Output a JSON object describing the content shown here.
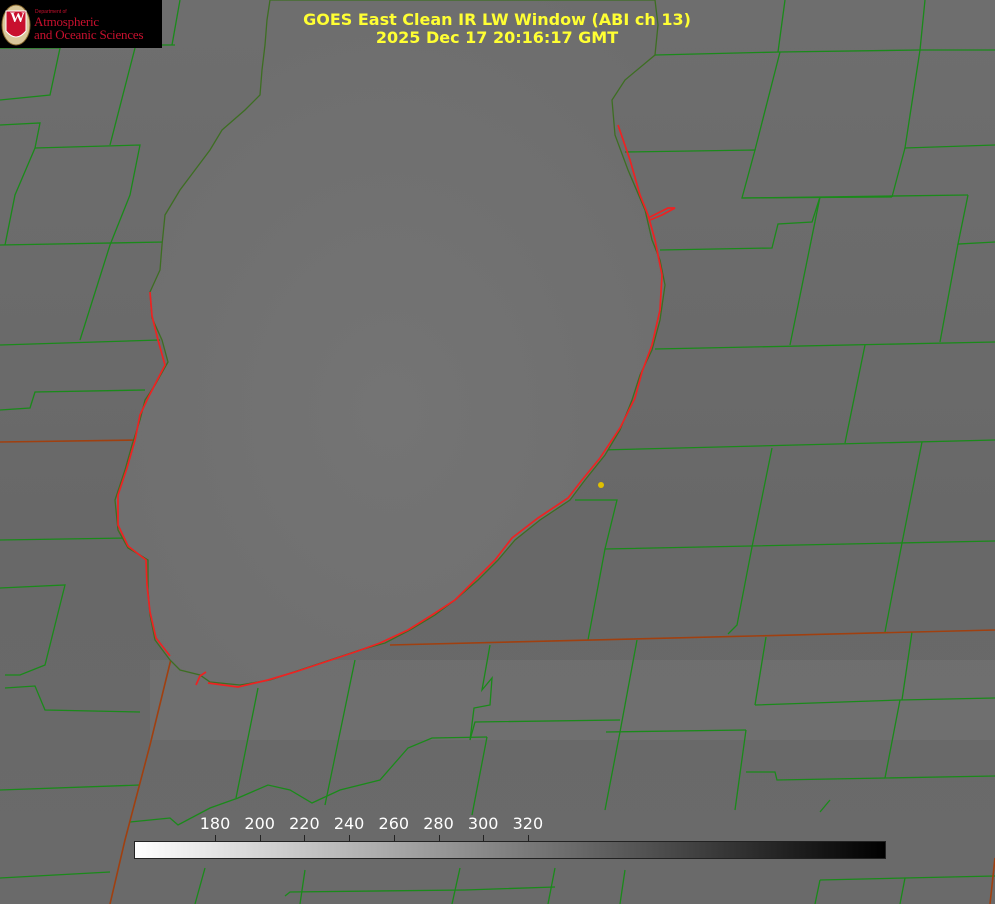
{
  "title": {
    "line1": "GOES East Clean IR LW Window (ABI ch 13)",
    "line2": "2025 Dec 17 20:16:17 GMT"
  },
  "logo": {
    "department": "Department of",
    "line1": "Atmospheric",
    "line2": "and Oceanic Sciences",
    "seal_letter": "W"
  },
  "colorbar": {
    "labels": [
      "180",
      "200",
      "220",
      "240",
      "260",
      "280",
      "300",
      "320"
    ],
    "values": [
      180,
      200,
      220,
      240,
      260,
      280,
      300,
      320
    ],
    "gradient": "white-to-black"
  },
  "colors": {
    "county_lines": "#1a8a1a",
    "coastline": "#ee2222",
    "state_line": "#a04010",
    "marker": "#e0c000",
    "title_text": "#ffff33",
    "brand_red": "#c8102e"
  }
}
